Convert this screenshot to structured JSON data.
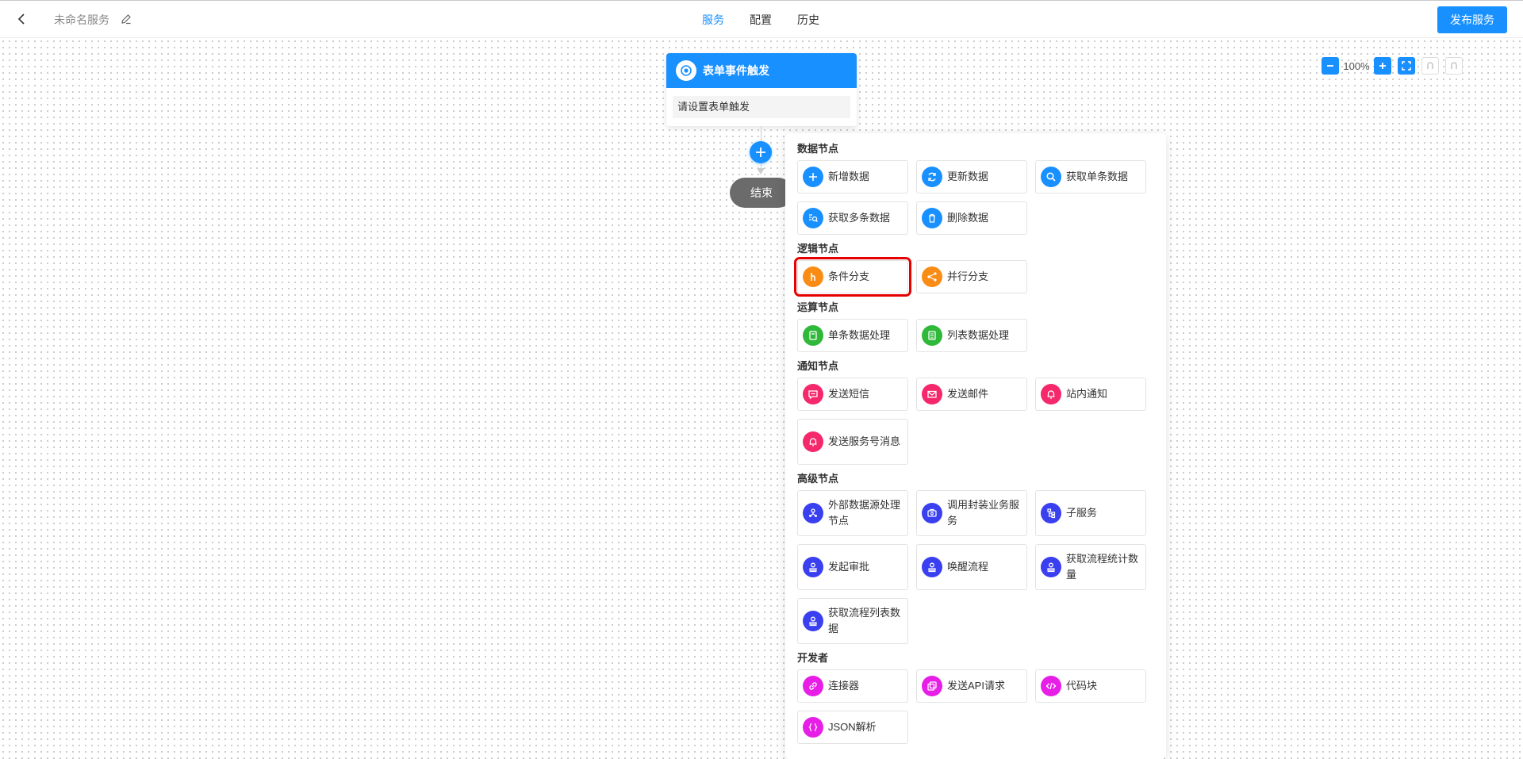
{
  "header": {
    "service_name": "未命名服务",
    "tabs": [
      {
        "label": "服务",
        "active": true
      },
      {
        "label": "配置",
        "active": false
      },
      {
        "label": "历史",
        "active": false
      }
    ],
    "publish_label": "发布服务"
  },
  "zoom": {
    "level": "100%"
  },
  "flow": {
    "trigger_title": "表单事件触发",
    "trigger_body": "请设置表单触发",
    "end_label": "结束"
  },
  "panel": {
    "groups": [
      {
        "title": "数据节点",
        "items": [
          {
            "label": "新增数据",
            "icon": "plus-icon",
            "color": "#1890ff"
          },
          {
            "label": "更新数据",
            "icon": "refresh-icon",
            "color": "#1890ff"
          },
          {
            "label": "获取单条数据",
            "icon": "search-icon",
            "color": "#1890ff"
          },
          {
            "label": "获取多条数据",
            "icon": "list-search-icon",
            "color": "#1890ff"
          },
          {
            "label": "删除数据",
            "icon": "trash-icon",
            "color": "#1890ff"
          }
        ]
      },
      {
        "title": "逻辑节点",
        "items": [
          {
            "label": "条件分支",
            "icon": "branch-icon",
            "color": "#fa8c16",
            "highlighted": true
          },
          {
            "label": "并行分支",
            "icon": "share-icon",
            "color": "#fa8c16"
          }
        ]
      },
      {
        "title": "运算节点",
        "items": [
          {
            "label": "单条数据处理",
            "icon": "calculator-icon",
            "color": "#2fb83a"
          },
          {
            "label": "列表数据处理",
            "icon": "list-icon",
            "color": "#2fb83a"
          }
        ]
      },
      {
        "title": "通知节点",
        "items": [
          {
            "label": "发送短信",
            "icon": "message-icon",
            "color": "#f5286b"
          },
          {
            "label": "发送邮件",
            "icon": "mail-icon",
            "color": "#f5286b"
          },
          {
            "label": "站内通知",
            "icon": "bell-icon",
            "color": "#f5286b"
          },
          {
            "label": "发送服务号消息",
            "icon": "bell-icon",
            "color": "#f5286b"
          }
        ]
      },
      {
        "title": "高级节点",
        "items": [
          {
            "label": "外部数据源处理节点",
            "icon": "node-icon",
            "color": "#3a3ff0"
          },
          {
            "label": "调用封装业务服务",
            "icon": "package-icon",
            "color": "#3a3ff0"
          },
          {
            "label": "子服务",
            "icon": "tree-icon",
            "color": "#3a3ff0"
          },
          {
            "label": "发起审批",
            "icon": "stamp-icon",
            "color": "#3a3ff0"
          },
          {
            "label": "唤醒流程",
            "icon": "stamp-icon",
            "color": "#3a3ff0"
          },
          {
            "label": "获取流程统计数量",
            "icon": "stamp-icon",
            "color": "#3a3ff0"
          },
          {
            "label": "获取流程列表数据",
            "icon": "stamp-icon",
            "color": "#3a3ff0"
          }
        ]
      },
      {
        "title": "开发者",
        "items": [
          {
            "label": "连接器",
            "icon": "link-icon",
            "color": "#e61ee6"
          },
          {
            "label": "发送API请求",
            "icon": "copy-icon",
            "color": "#e61ee6"
          },
          {
            "label": "代码块",
            "icon": "code-icon",
            "color": "#e61ee6"
          },
          {
            "label": "JSON解析",
            "icon": "json-icon",
            "color": "#e61ee6"
          }
        ]
      }
    ]
  }
}
